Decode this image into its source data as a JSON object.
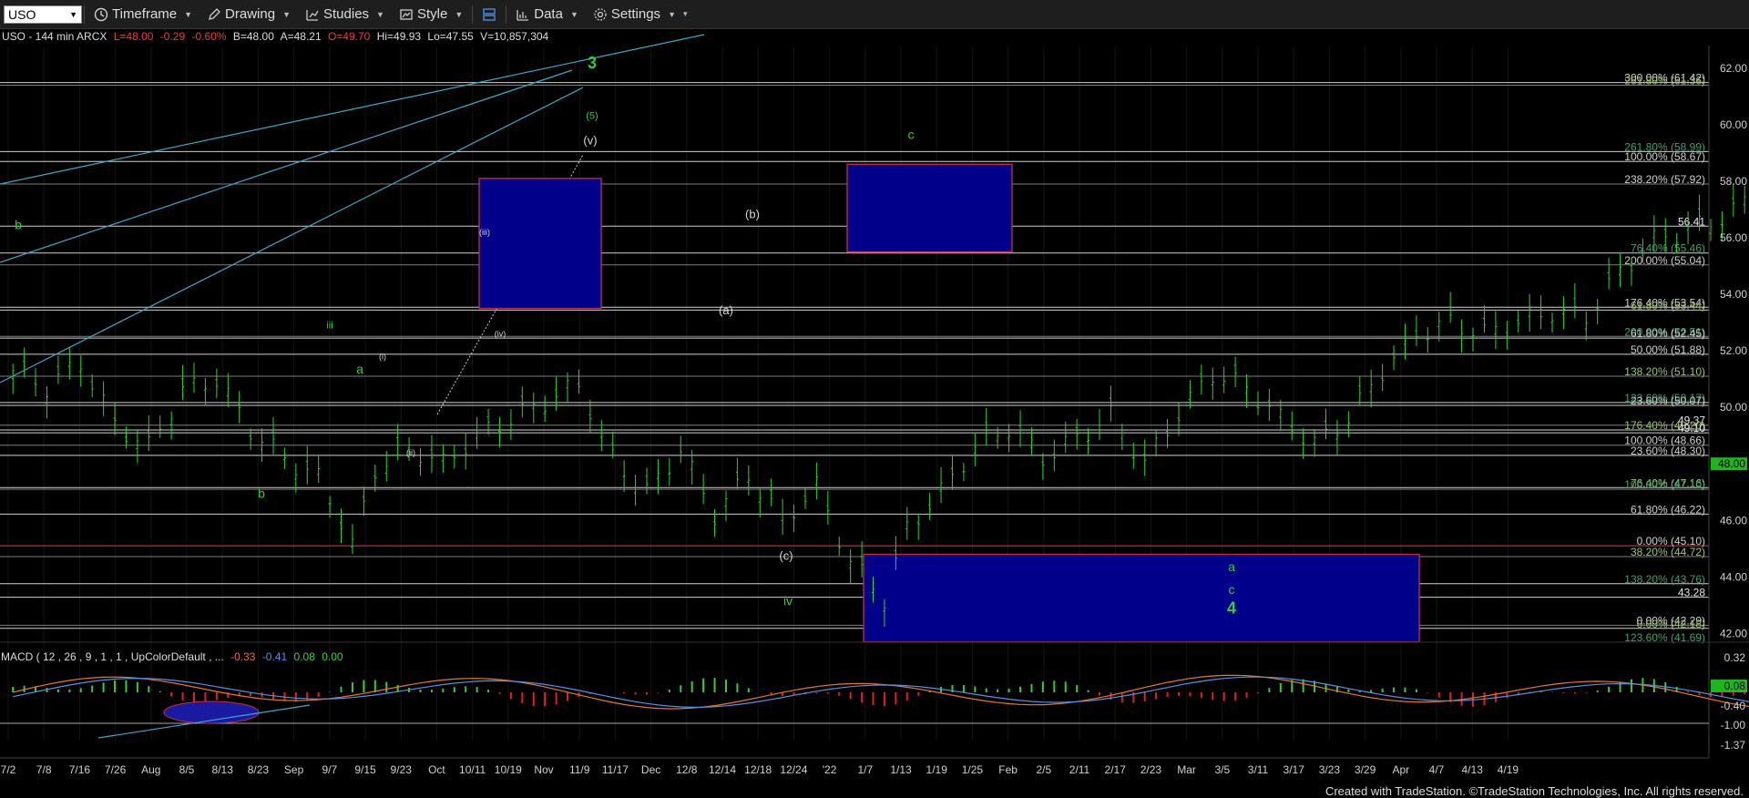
{
  "toolbar": {
    "symbol": "USO",
    "timeframe": "Timeframe",
    "drawing": "Drawing",
    "studies": "Studies",
    "style": "Style",
    "data": "Data",
    "settings": "Settings"
  },
  "header": {
    "title": "USO - 144 min  ARCX",
    "last": "L=48.00",
    "chg": "-0.29",
    "pct": "-0.60%",
    "bid": "B=48.00",
    "ask": "A=48.21",
    "open": "O=49.70",
    "hi": "Hi=49.93",
    "lo": "Lo=47.55",
    "vol": "V=10,857,304"
  },
  "chart_data": {
    "type": "candlestick",
    "y_range": [
      40.4,
      62.8
    ],
    "y_ticks": [
      42,
      44,
      46,
      48,
      50,
      52,
      54,
      56,
      58,
      60,
      62
    ],
    "last_price": 48.0,
    "x_ticks": [
      "7/2",
      "7/8",
      "7/16",
      "7/26",
      "Aug",
      "8/5",
      "8/13",
      "8/23",
      "Sep",
      "9/7",
      "9/15",
      "9/23",
      "Oct",
      "10/11",
      "10/19",
      "Nov",
      "11/9",
      "11/17",
      "Dec",
      "12/8",
      "12/14",
      "12/18",
      "12/24",
      "'22",
      "1/7",
      "1/13",
      "1/19",
      "1/25",
      "Feb",
      "2/5",
      "2/11",
      "2/17",
      "2/23",
      "Mar",
      "3/5",
      "3/11",
      "3/17",
      "3/23",
      "3/29",
      "Apr",
      "4/7",
      "4/13",
      "4/19"
    ],
    "price_path": [
      [
        0,
        51.3
      ],
      [
        3,
        50.7
      ],
      [
        6,
        51.6
      ],
      [
        9,
        49.4
      ],
      [
        12,
        48.6
      ],
      [
        15,
        50.6
      ],
      [
        18,
        51.0
      ],
      [
        21,
        49.2
      ],
      [
        24,
        48.2
      ],
      [
        27,
        47.5
      ],
      [
        29,
        46.0
      ],
      [
        30,
        45.1
      ],
      [
        32,
        47.8
      ],
      [
        35,
        48.6
      ],
      [
        38,
        48.0
      ],
      [
        41,
        49.0
      ],
      [
        44,
        49.6
      ],
      [
        47,
        50.2
      ],
      [
        50,
        50.8
      ],
      [
        53,
        48.2
      ],
      [
        56,
        47.0
      ],
      [
        59,
        48.5
      ],
      [
        62,
        46.2
      ],
      [
        65,
        47.6
      ],
      [
        68,
        46.0
      ],
      [
        71,
        47.2
      ],
      [
        74,
        44.5
      ],
      [
        76,
        43.7
      ],
      [
        77,
        43.2
      ],
      [
        79,
        45.7
      ],
      [
        82,
        47.0
      ],
      [
        85,
        48.6
      ],
      [
        88,
        49.3
      ],
      [
        91,
        48.2
      ],
      [
        94,
        48.9
      ],
      [
        97,
        49.7
      ],
      [
        100,
        48.0
      ],
      [
        103,
        49.8
      ],
      [
        106,
        51.2
      ],
      [
        109,
        50.7
      ],
      [
        112,
        49.6
      ],
      [
        115,
        48.7
      ],
      [
        118,
        49.6
      ],
      [
        121,
        51.3
      ],
      [
        124,
        52.6
      ],
      [
        127,
        53.0
      ],
      [
        130,
        52.6
      ],
      [
        133,
        53.0
      ],
      [
        136,
        53.4
      ],
      [
        139,
        53.2
      ],
      [
        142,
        54.8
      ],
      [
        145,
        55.9
      ],
      [
        148,
        56.3
      ],
      [
        151,
        56.7
      ],
      [
        154,
        57.5
      ],
      [
        157,
        57.7
      ],
      [
        160,
        57.8
      ],
      [
        163,
        57.6
      ],
      [
        166,
        57.4
      ],
      [
        169,
        58.4
      ],
      [
        172,
        58.6
      ],
      [
        174,
        57.6
      ],
      [
        176,
        56.3
      ],
      [
        179,
        57.6
      ],
      [
        182,
        58.0
      ],
      [
        185,
        57.3
      ],
      [
        188,
        56.6
      ],
      [
        191,
        55.3
      ],
      [
        194,
        56.2
      ],
      [
        197,
        57.5
      ],
      [
        200,
        57.7
      ],
      [
        203,
        57.6
      ],
      [
        206,
        56.4
      ],
      [
        209,
        57.4
      ],
      [
        212,
        56.0
      ],
      [
        215,
        55.3
      ],
      [
        218,
        54.5
      ],
      [
        221,
        53.4
      ],
      [
        224,
        56.2
      ],
      [
        227,
        56.0
      ],
      [
        229,
        55.2
      ],
      [
        231,
        52.6
      ],
      [
        233,
        50.3
      ],
      [
        235,
        48.6
      ],
      [
        237,
        47.5
      ],
      [
        239,
        46.6
      ],
      [
        241,
        48.2
      ],
      [
        243,
        45.6
      ],
      [
        245,
        47.7
      ],
      [
        248,
        49.5
      ]
    ],
    "levels_grey": [
      [
        61.49,
        "300.00% (61.42)"
      ],
      [
        61.4,
        "261.80% (61.36)"
      ],
      [
        59.05,
        "261.80% (58.99)"
      ],
      [
        58.7,
        "100.00% (58.67)"
      ],
      [
        57.9,
        "238.20% (57.92)"
      ],
      [
        56.41,
        "56.41"
      ],
      [
        55.46,
        "76.40% (55.46)"
      ],
      [
        55.04,
        "200.00% (55.04)"
      ],
      [
        53.54,
        "176.40% (53.54)"
      ],
      [
        53.44,
        "61.80% (53.44)"
      ],
      [
        52.51,
        "200.00% (52.51)"
      ],
      [
        52.45,
        "61.80% (52.45)"
      ],
      [
        51.88,
        "50.00% (51.88)"
      ],
      [
        51.1,
        "138.20% (51.10)"
      ],
      [
        50.17,
        "123.60% (50.17)"
      ],
      [
        50.07,
        "23.60% (50.07)"
      ],
      [
        49.37,
        "49.37"
      ],
      [
        49.2,
        "176.40% (49.20)"
      ],
      [
        49.1,
        "49.10"
      ],
      [
        48.66,
        "100.00% (48.66)"
      ],
      [
        48.3,
        "23.60% (48.30)"
      ],
      [
        47.16,
        "76.40% (47.16)"
      ],
      [
        47.1,
        "100.00% (47.10)"
      ],
      [
        46.22,
        "61.80% (46.22)"
      ],
      [
        45.1,
        "0.00% (45.10)"
      ],
      [
        44.72,
        "38.20% (44.72)"
      ],
      [
        43.76,
        "138.20% (43.76)"
      ],
      [
        43.28,
        "43.28"
      ],
      [
        42.29,
        "0.00% (42.29)"
      ],
      [
        42.18,
        "0.00% (42.18)"
      ],
      [
        41.69,
        "123.60% (41.69)"
      ]
    ],
    "boxes": [
      [
        0,
        53.5,
        58.1,
        1.3
      ],
      [
        1,
        55.5,
        58.6,
        1.3
      ],
      [
        2,
        41.7,
        44.8,
        1.3
      ]
    ],
    "annotations_green": [
      [
        "3",
        62.0
      ],
      [
        "(5)",
        60.2
      ],
      [
        "c",
        59.5
      ],
      [
        "b",
        56.3
      ],
      [
        "iii",
        52.8
      ],
      [
        "a",
        51.2
      ],
      [
        "b",
        46.8
      ],
      [
        "iv",
        43.0
      ],
      [
        "a",
        44.2
      ],
      [
        "c",
        43.4
      ],
      [
        "4",
        42.7
      ]
    ],
    "annotations_white": [
      [
        "(v)",
        59.3
      ],
      [
        "(b)",
        56.7
      ],
      [
        "(a)",
        53.3
      ],
      [
        "(c)",
        44.6
      ],
      [
        "(iii)",
        56.1
      ],
      [
        "(iv)",
        52.5
      ],
      [
        "(i)",
        51.7
      ],
      [
        "(ii)",
        48.3
      ]
    ]
  },
  "macd": {
    "label": "MACD ( 12 , 26 , 9 , 1 , 1 , UpColorDefault , ...",
    "v1": "-0.33",
    "v2": "-0.41",
    "v3": "0.08",
    "v4": "0.00",
    "ticks": [
      "0.32",
      "0.08",
      "-0.40",
      "-1.00",
      "-1.37"
    ]
  },
  "footer": "Created with TradeStation. ©TradeStation Technologies, Inc. All rights reserved."
}
